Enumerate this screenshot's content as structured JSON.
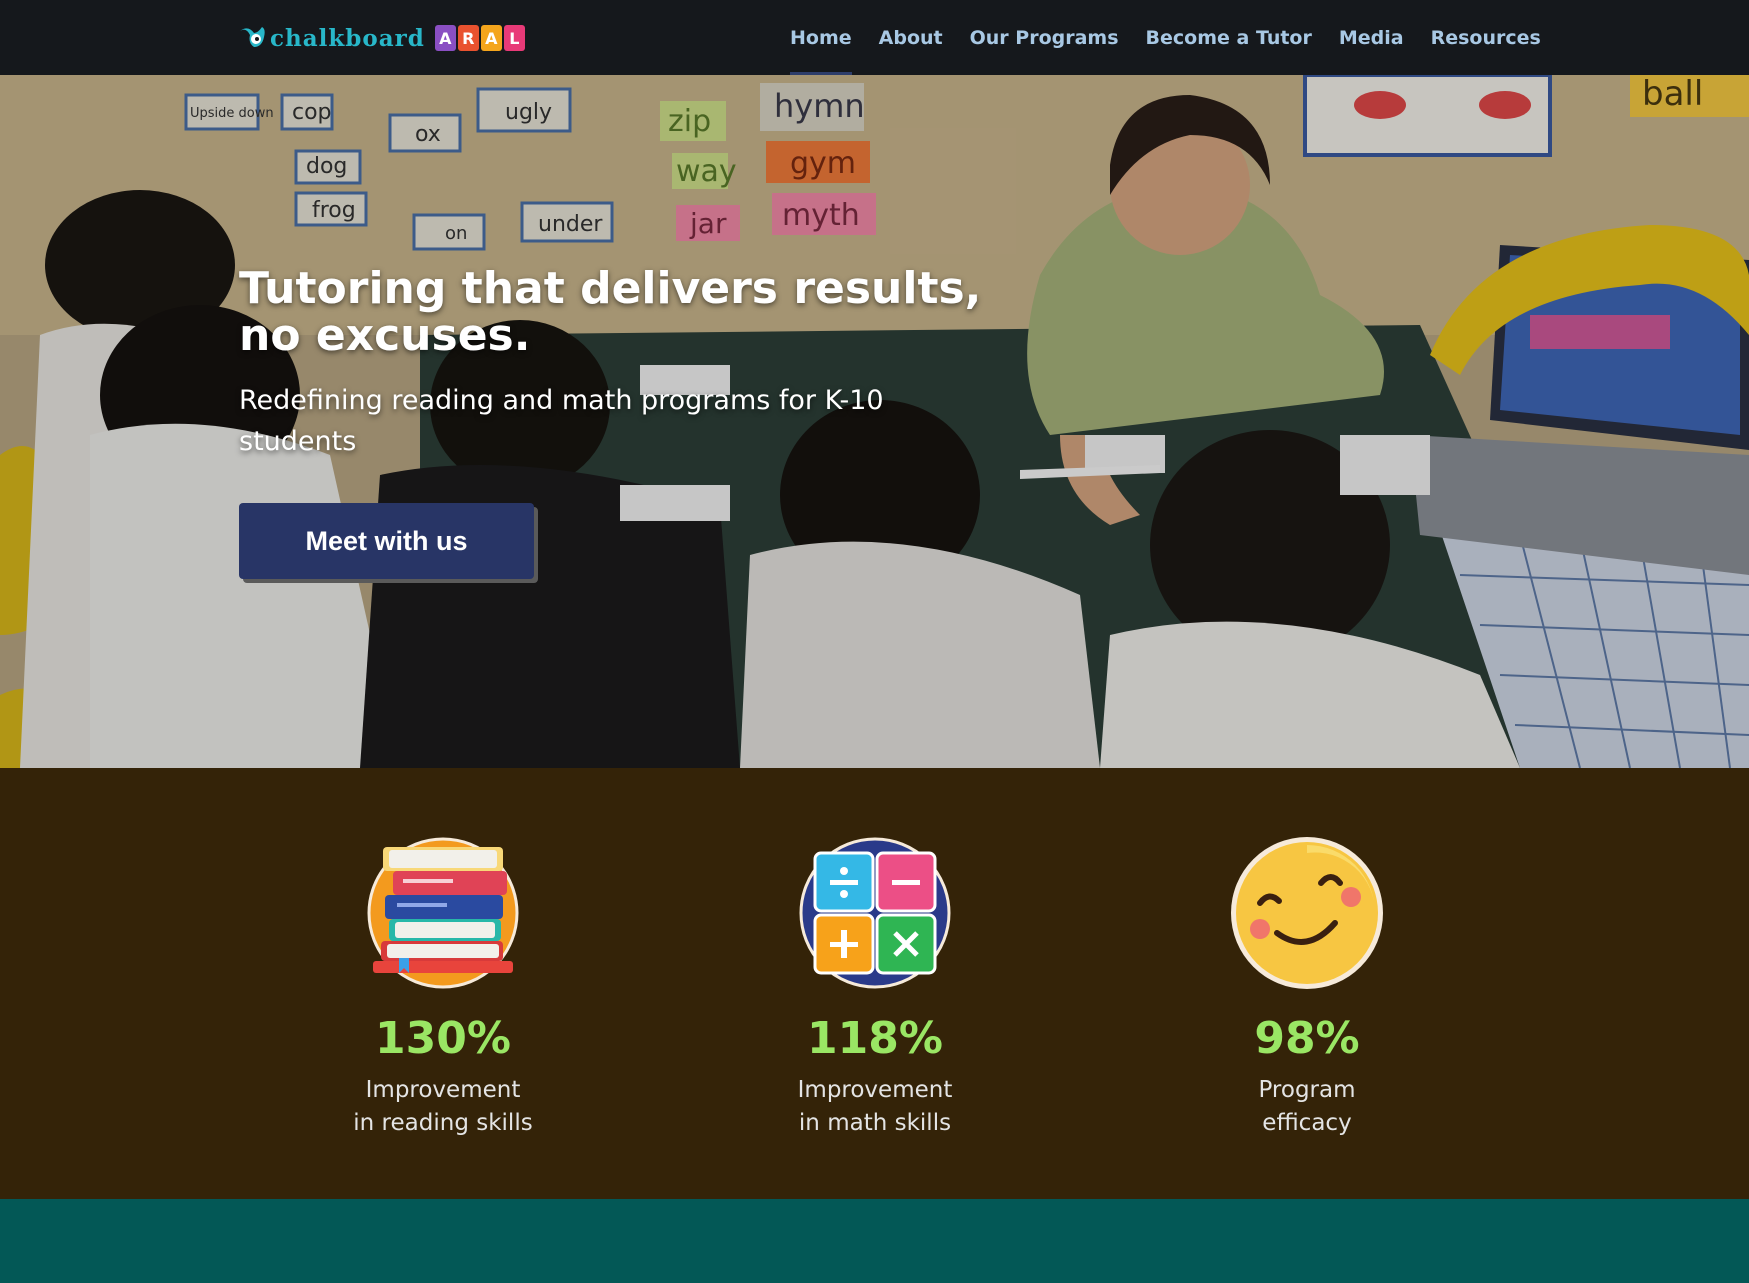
{
  "brand": {
    "word": "chalkboard",
    "tiles": [
      {
        "letter": "A",
        "color": "#8a4fc3"
      },
      {
        "letter": "R",
        "color": "#e9522f"
      },
      {
        "letter": "A",
        "color": "#f4a51c"
      },
      {
        "letter": "L",
        "color": "#e83a78"
      }
    ]
  },
  "nav": {
    "items": [
      {
        "label": "Home",
        "active": true
      },
      {
        "label": "About",
        "active": false
      },
      {
        "label": "Our Programs",
        "active": false
      },
      {
        "label": "Become a Tutor",
        "active": false
      },
      {
        "label": "Media",
        "active": false
      },
      {
        "label": "Resources",
        "active": false
      }
    ]
  },
  "hero": {
    "title": "Tutoring that delivers results, no excuses.",
    "subtitle": "Redefining reading and math programs for K-10 students",
    "cta_label": "Meet with us",
    "wall_words": [
      "Upside down",
      "cop",
      "ox",
      "ugly",
      "zip",
      "hymn",
      "dog",
      "way",
      "gym",
      "frog",
      "jar",
      "myth",
      "on",
      "under",
      "ball"
    ]
  },
  "stats": [
    {
      "value": "130%",
      "line1": "Improvement",
      "line2": "in reading skills",
      "icon": "books-stack-icon"
    },
    {
      "value": "118%",
      "line1": "Improvement",
      "line2": "in math skills",
      "icon": "math-operators-icon"
    },
    {
      "value": "98%",
      "line1": "Program",
      "line2": "efficacy",
      "icon": "smiley-face-icon"
    }
  ],
  "colors": {
    "nav_bg": "#15181c",
    "nav_text": "#a8c8e4",
    "cta_bg": "#283566",
    "stats_bg": "#342308",
    "stat_value": "#9ae664",
    "footer_band": "#035856"
  }
}
